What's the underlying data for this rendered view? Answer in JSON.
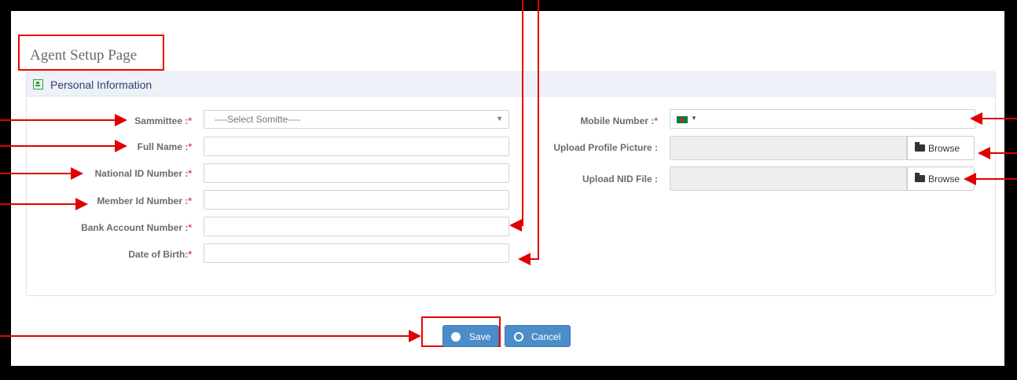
{
  "page_title": "Agent Setup Page",
  "panel": {
    "title": "Personal Information"
  },
  "left_fields": {
    "sammittee": {
      "label": "Sammittee :",
      "required": "*",
      "placeholder": "----Select Somitte----"
    },
    "full_name": {
      "label": "Full Name :",
      "required": "*",
      "value": ""
    },
    "national_id": {
      "label": "National ID Number :",
      "required": "*",
      "value": ""
    },
    "member_id": {
      "label": "Member Id Number :",
      "required": "*",
      "value": ""
    },
    "bank_account": {
      "label": "Bank Account Number :",
      "required": "*",
      "value": ""
    },
    "dob": {
      "label": "Date of Birth:",
      "required": "*",
      "value": ""
    }
  },
  "right_fields": {
    "mobile": {
      "label": "Mobile Number :",
      "required": "*",
      "value": "",
      "flag": "bd-flag-icon"
    },
    "profile_picture": {
      "label": "Upload Profile Picture :",
      "browse_label": "Browse"
    },
    "nid_file": {
      "label": "Upload NID File :",
      "browse_label": "Browse"
    }
  },
  "actions": {
    "save_label": "Save",
    "cancel_label": "Cancel"
  },
  "colors": {
    "annotation": "#e00000",
    "button": "#4a8dc9",
    "panel_header": "#eef1f7"
  }
}
